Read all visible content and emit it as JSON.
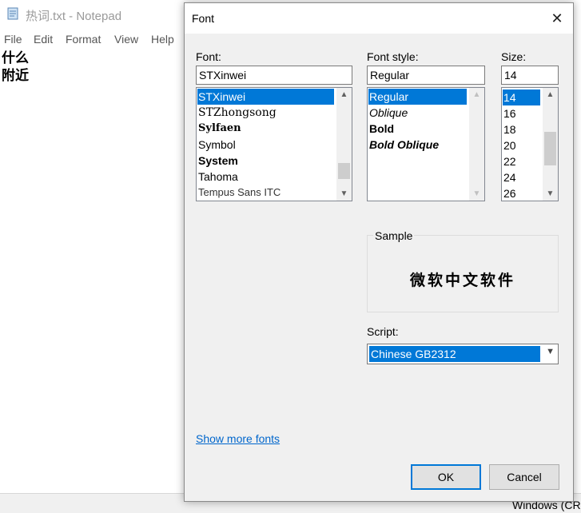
{
  "notepad": {
    "title": "热词.txt - Notepad",
    "menu": [
      "File",
      "Edit",
      "Format",
      "View",
      "Help"
    ],
    "lines": [
      "什么",
      "附近"
    ],
    "status": "Windows (CR"
  },
  "dialog": {
    "title": "Font",
    "close_glyph": "✕",
    "font_label": "Font:",
    "font_value": "STXinwei",
    "font_list": [
      "STXinwei",
      "STZhongsong",
      "Sylfaen",
      "Symbol",
      "System",
      "Tahoma",
      "Tempus Sans ITC"
    ],
    "font_selected": "STXinwei",
    "style_label": "Font style:",
    "style_value": "Regular",
    "style_list": [
      "Regular",
      "Oblique",
      "Bold",
      "Bold Oblique"
    ],
    "size_label": "Size:",
    "size_value": "14",
    "size_list": [
      "14",
      "16",
      "18",
      "20",
      "22",
      "24",
      "26"
    ],
    "sample_label": "Sample",
    "sample_text": "微软中文软件",
    "script_label": "Script:",
    "script_value": "Chinese GB2312",
    "more_fonts_link": "Show more fonts",
    "ok_label": "OK",
    "cancel_label": "Cancel",
    "accent_color": "#0078d7"
  }
}
